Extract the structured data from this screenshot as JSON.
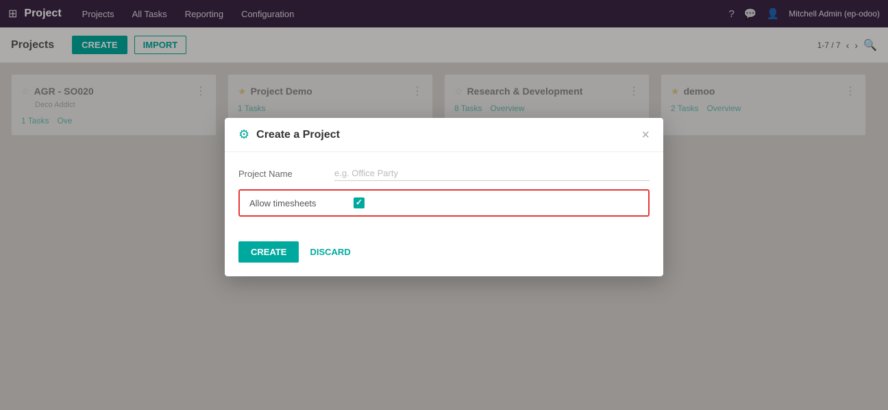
{
  "navbar": {
    "brand": "Project",
    "menu": [
      "Projects",
      "All Tasks",
      "Reporting",
      "Configuration"
    ],
    "user": "Mitchell Admin (ep-odoo)",
    "grid_icon": "⊞",
    "question_icon": "?",
    "chat_icon": "💬",
    "person_icon": "👤"
  },
  "subheader": {
    "title": "Projects",
    "create_label": "CREATE",
    "import_label": "IMPORT",
    "pagination": "1-7 / 7"
  },
  "projects": [
    {
      "name": "AGR - SO020",
      "sub": "Deco Addict",
      "tasks": "1 Tasks",
      "overview": "Ove",
      "starred": false
    },
    {
      "name": "Project Demo",
      "sub": "",
      "tasks": "1 Tasks",
      "overview": "",
      "starred": true
    },
    {
      "name": "Research & Development",
      "sub": "",
      "tasks": "8 Tasks",
      "overview": "Overview",
      "starred": false
    },
    {
      "name": "demoo",
      "sub": "",
      "tasks": "2 Tasks",
      "overview": "Overview",
      "starred": true
    }
  ],
  "modal": {
    "title": "Create a Project",
    "icon": "⚙",
    "close_label": "×",
    "project_name_label": "Project Name",
    "project_name_placeholder": "e.g. Office Party",
    "allow_timesheets_label": "Allow timesheets",
    "create_label": "CREATE",
    "discard_label": "DISCARD"
  }
}
